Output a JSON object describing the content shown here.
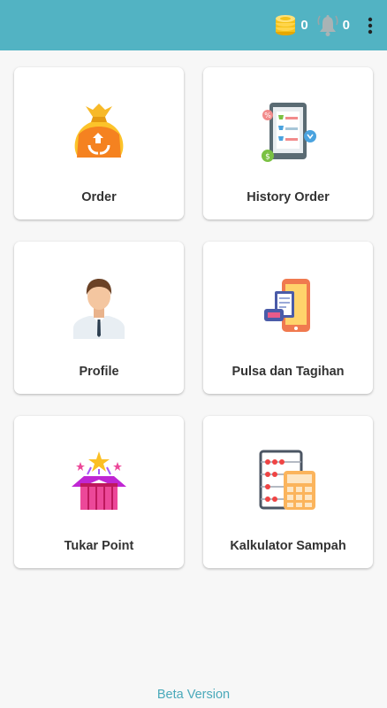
{
  "appbar": {
    "coins": {
      "icon": "coins-icon",
      "value": "0"
    },
    "notifications": {
      "icon": "bell-icon",
      "value": "0"
    },
    "menu_icon": "more-vert-icon",
    "color": "#52b3c3"
  },
  "menu": [
    {
      "label": "Order",
      "icon": "trash-bag-recycle-icon"
    },
    {
      "label": "History Order",
      "icon": "receipt-history-icon"
    },
    {
      "label": "Profile",
      "icon": "user-avatar-icon"
    },
    {
      "label": "Pulsa dan Tagihan",
      "icon": "phone-bill-icon"
    },
    {
      "label": "Tukar Point",
      "icon": "gift-box-stars-icon"
    },
    {
      "label": "Kalkulator Sampah",
      "icon": "abacus-calculator-icon"
    }
  ],
  "footer": {
    "text": "Beta Version"
  }
}
